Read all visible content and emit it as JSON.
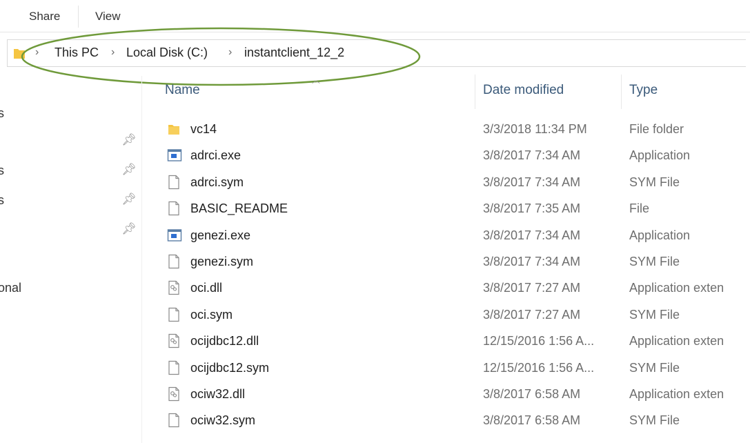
{
  "ribbon": {
    "tabs": [
      "Share",
      "View"
    ]
  },
  "address": {
    "crumbs": [
      "This PC",
      "Local Disk (C:)",
      "instantclient_12_2"
    ]
  },
  "nav": {
    "fragments": [
      "s",
      "s",
      "s",
      "onal"
    ]
  },
  "columns": {
    "name": "Name",
    "date": "Date modified",
    "type": "Type"
  },
  "files": [
    {
      "name": "vc14",
      "date": "3/3/2018 11:34 PM",
      "type": "File folder",
      "icon": "folder-icon"
    },
    {
      "name": "adrci.exe",
      "date": "3/8/2017 7:34 AM",
      "type": "Application",
      "icon": "application-icon"
    },
    {
      "name": "adrci.sym",
      "date": "3/8/2017 7:34 AM",
      "type": "SYM File",
      "icon": "file-icon"
    },
    {
      "name": "BASIC_README",
      "date": "3/8/2017 7:35 AM",
      "type": "File",
      "icon": "file-icon"
    },
    {
      "name": "genezi.exe",
      "date": "3/8/2017 7:34 AM",
      "type": "Application",
      "icon": "application-icon"
    },
    {
      "name": "genezi.sym",
      "date": "3/8/2017 7:34 AM",
      "type": "SYM File",
      "icon": "file-icon"
    },
    {
      "name": "oci.dll",
      "date": "3/8/2017 7:27 AM",
      "type": "Application exten",
      "icon": "dll-icon"
    },
    {
      "name": "oci.sym",
      "date": "3/8/2017 7:27 AM",
      "type": "SYM File",
      "icon": "file-icon"
    },
    {
      "name": "ocijdbc12.dll",
      "date": "12/15/2016 1:56 A...",
      "type": "Application exten",
      "icon": "dll-icon"
    },
    {
      "name": "ocijdbc12.sym",
      "date": "12/15/2016 1:56 A...",
      "type": "SYM File",
      "icon": "file-icon"
    },
    {
      "name": "ociw32.dll",
      "date": "3/8/2017 6:58 AM",
      "type": "Application exten",
      "icon": "dll-icon"
    },
    {
      "name": "ociw32.sym",
      "date": "3/8/2017 6:58 AM",
      "type": "SYM File",
      "icon": "file-icon"
    }
  ],
  "colors": {
    "highlight_ellipse": "#6f9a3a",
    "header_text": "#3b5a7a",
    "folder": "#f5c542"
  }
}
